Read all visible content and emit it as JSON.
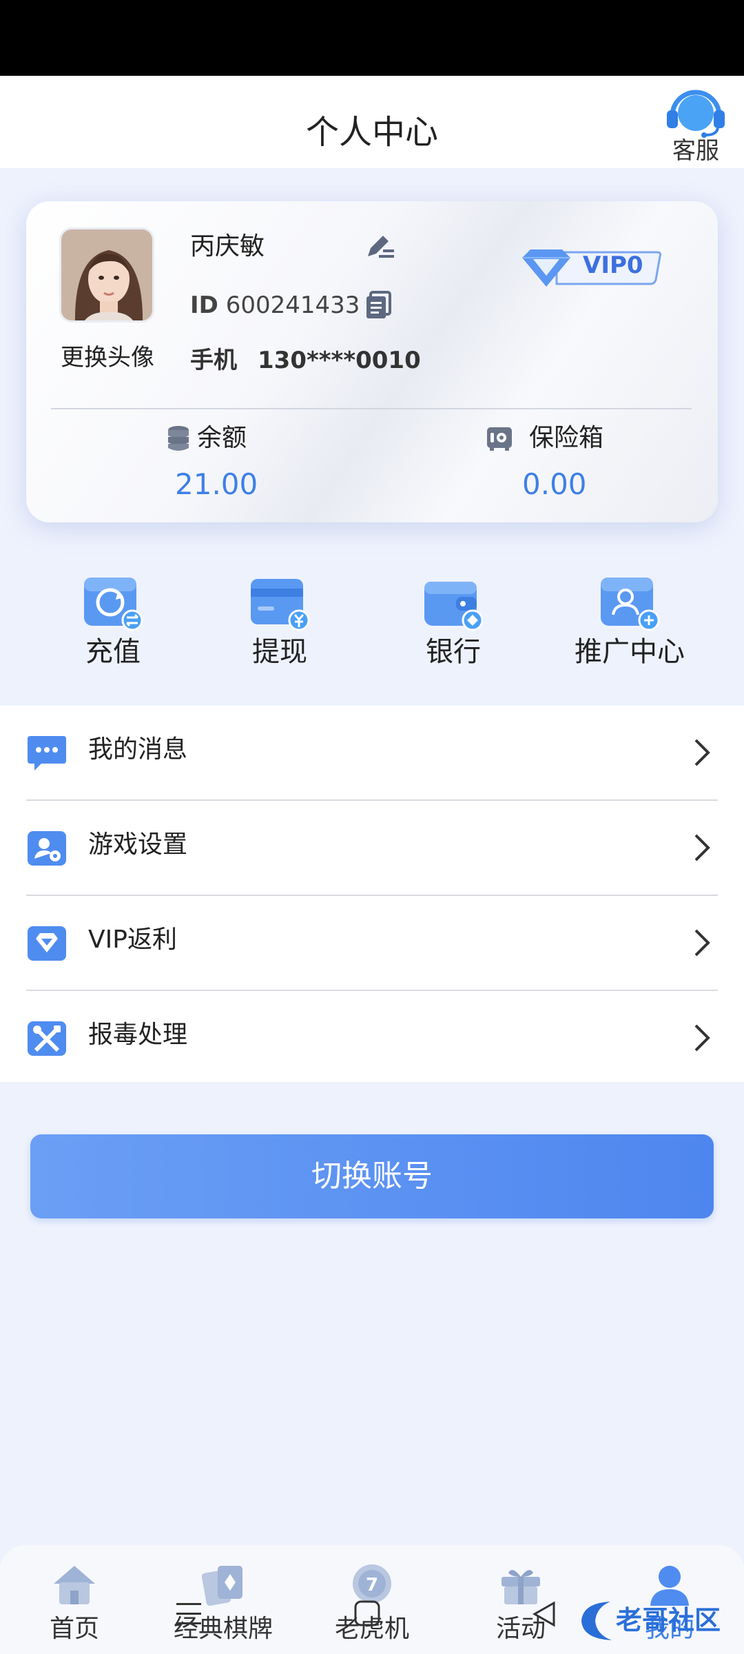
{
  "header": {
    "title": "个人中心",
    "service_label": "客服"
  },
  "profile": {
    "username": "丙庆敏",
    "id_prefix": "ID",
    "id_value": "600241433",
    "change_avatar_label": "更换头像",
    "phone_label": "手机",
    "phone_value": "130****0010",
    "vip_label": "VIP0"
  },
  "balances": {
    "balance_label": "余额",
    "balance_value": "21.00",
    "safe_label": "保险箱",
    "safe_value": "0.00"
  },
  "actions": [
    {
      "label": "充值"
    },
    {
      "label": "提现"
    },
    {
      "label": "银行"
    },
    {
      "label": "推广中心"
    }
  ],
  "menu": [
    {
      "label": "我的消息"
    },
    {
      "label": "游戏设置"
    },
    {
      "label": "VIP返利"
    },
    {
      "label": "报毒处理"
    }
  ],
  "switch_account_label": "切换账号",
  "tabs": [
    {
      "label": "首页"
    },
    {
      "label": "经典棋牌"
    },
    {
      "label": "老虎机"
    },
    {
      "label": "活动"
    },
    {
      "label": "我的"
    }
  ],
  "watermark_text": "老哥社区",
  "colors": {
    "accent": "#3e80e6",
    "button": "#5b92f2",
    "background": "#eef2fd"
  }
}
